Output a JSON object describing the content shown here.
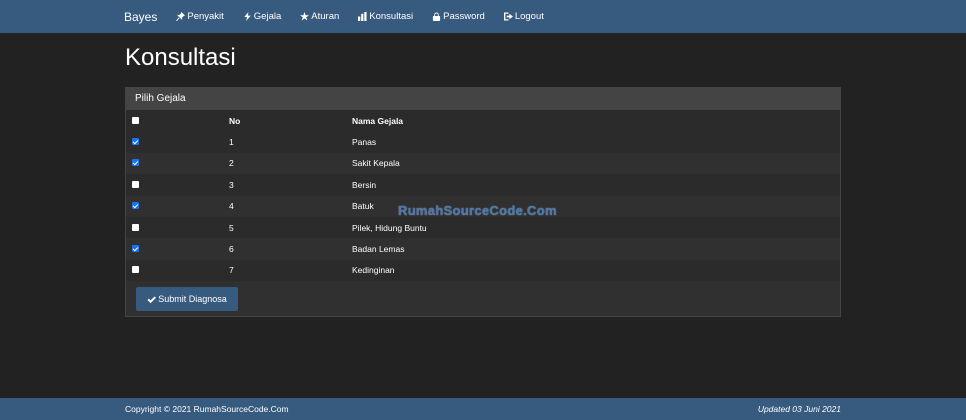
{
  "navbar": {
    "brand": "Bayes",
    "items": [
      {
        "label": "Penyakit",
        "icon": "pushpin-icon"
      },
      {
        "label": "Gejala",
        "icon": "flash-icon"
      },
      {
        "label": "Aturan",
        "icon": "star-icon"
      },
      {
        "label": "Konsultasi",
        "icon": "stats-icon"
      },
      {
        "label": "Password",
        "icon": "lock-icon"
      },
      {
        "label": "Logout",
        "icon": "logout-icon"
      }
    ]
  },
  "page": {
    "title": "Konsultasi"
  },
  "panel": {
    "heading": "Pilih Gejala",
    "columns": {
      "no": "No",
      "name": "Nama Gejala"
    },
    "rows": [
      {
        "no": "1",
        "name": "Panas",
        "checked": true
      },
      {
        "no": "2",
        "name": "Sakit Kepala",
        "checked": true
      },
      {
        "no": "3",
        "name": "Bersin",
        "checked": false
      },
      {
        "no": "4",
        "name": "Batuk",
        "checked": true
      },
      {
        "no": "5",
        "name": "Pilek, Hidung Buntu",
        "checked": false
      },
      {
        "no": "6",
        "name": "Badan Lemas",
        "checked": true
      },
      {
        "no": "7",
        "name": "Kedinginan",
        "checked": false
      }
    ],
    "submit_label": "Submit Diagnosa"
  },
  "watermark": "RumahSourceCode.Com",
  "footer": {
    "copyright": "Copyright © 2021 RumahSourceCode.Com",
    "updated": "Updated 03 Juni 2021"
  },
  "colors": {
    "navbar": "#375a7f",
    "background": "#222222",
    "panel": "#303030",
    "accent": "#1a73e8"
  }
}
